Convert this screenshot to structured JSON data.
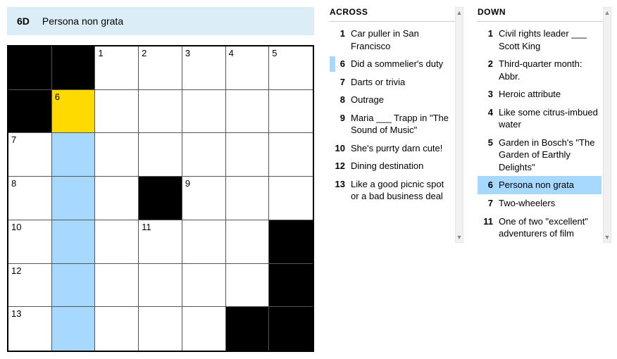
{
  "current_clue": {
    "id": "6D",
    "text": "Persona non grata"
  },
  "grid": {
    "rows": 7,
    "cols": 7,
    "cells": [
      {
        "r": 0,
        "c": 0,
        "black": true
      },
      {
        "r": 0,
        "c": 1,
        "black": true
      },
      {
        "r": 0,
        "c": 2,
        "num": "1"
      },
      {
        "r": 0,
        "c": 3,
        "num": "2"
      },
      {
        "r": 0,
        "c": 4,
        "num": "3"
      },
      {
        "r": 0,
        "c": 5,
        "num": "4"
      },
      {
        "r": 0,
        "c": 6,
        "num": "5"
      },
      {
        "r": 1,
        "c": 0,
        "black": true
      },
      {
        "r": 1,
        "c": 1,
        "num": "6",
        "focus": true
      },
      {
        "r": 1,
        "c": 2
      },
      {
        "r": 1,
        "c": 3
      },
      {
        "r": 1,
        "c": 4
      },
      {
        "r": 1,
        "c": 5
      },
      {
        "r": 1,
        "c": 6
      },
      {
        "r": 2,
        "c": 0,
        "num": "7"
      },
      {
        "r": 2,
        "c": 1,
        "hl": true
      },
      {
        "r": 2,
        "c": 2
      },
      {
        "r": 2,
        "c": 3
      },
      {
        "r": 2,
        "c": 4
      },
      {
        "r": 2,
        "c": 5
      },
      {
        "r": 2,
        "c": 6
      },
      {
        "r": 3,
        "c": 0,
        "num": "8"
      },
      {
        "r": 3,
        "c": 1,
        "hl": true
      },
      {
        "r": 3,
        "c": 2
      },
      {
        "r": 3,
        "c": 3,
        "black": true
      },
      {
        "r": 3,
        "c": 4,
        "num": "9"
      },
      {
        "r": 3,
        "c": 5
      },
      {
        "r": 3,
        "c": 6
      },
      {
        "r": 4,
        "c": 0,
        "num": "10"
      },
      {
        "r": 4,
        "c": 1,
        "hl": true
      },
      {
        "r": 4,
        "c": 2
      },
      {
        "r": 4,
        "c": 3,
        "num": "11"
      },
      {
        "r": 4,
        "c": 4
      },
      {
        "r": 4,
        "c": 5
      },
      {
        "r": 4,
        "c": 6,
        "black": true
      },
      {
        "r": 5,
        "c": 0,
        "num": "12"
      },
      {
        "r": 5,
        "c": 1,
        "hl": true
      },
      {
        "r": 5,
        "c": 2
      },
      {
        "r": 5,
        "c": 3
      },
      {
        "r": 5,
        "c": 4
      },
      {
        "r": 5,
        "c": 5
      },
      {
        "r": 5,
        "c": 6,
        "black": true
      },
      {
        "r": 6,
        "c": 0,
        "num": "13"
      },
      {
        "r": 6,
        "c": 1,
        "hl": true
      },
      {
        "r": 6,
        "c": 2
      },
      {
        "r": 6,
        "c": 3
      },
      {
        "r": 6,
        "c": 4
      },
      {
        "r": 6,
        "c": 5,
        "black": true
      },
      {
        "r": 6,
        "c": 6,
        "black": true
      }
    ]
  },
  "across": {
    "heading": "ACROSS",
    "clues": [
      {
        "n": "1",
        "t": "Car puller in San Francisco"
      },
      {
        "n": "6",
        "t": "Did a sommelier's duty",
        "related": true
      },
      {
        "n": "7",
        "t": "Darts or trivia"
      },
      {
        "n": "8",
        "t": "Outrage"
      },
      {
        "n": "9",
        "t": "Maria ___ Trapp in \"The Sound of Music\""
      },
      {
        "n": "10",
        "t": "She's purrty darn cute!"
      },
      {
        "n": "12",
        "t": "Dining destination"
      },
      {
        "n": "13",
        "t": "Like a good picnic spot or a bad business deal"
      }
    ]
  },
  "down": {
    "heading": "DOWN",
    "clues": [
      {
        "n": "1",
        "t": "Civil rights leader ___ Scott King"
      },
      {
        "n": "2",
        "t": "Third-quarter month: Abbr."
      },
      {
        "n": "3",
        "t": "Heroic attribute"
      },
      {
        "n": "4",
        "t": "Like some citrus-imbued water"
      },
      {
        "n": "5",
        "t": "Garden in Bosch's \"The Garden of Earthly Delights\""
      },
      {
        "n": "6",
        "t": "Persona non grata",
        "selected": true
      },
      {
        "n": "7",
        "t": "Two-wheelers"
      },
      {
        "n": "11",
        "t": "One of two \"excellent\" adventurers of film"
      }
    ]
  }
}
